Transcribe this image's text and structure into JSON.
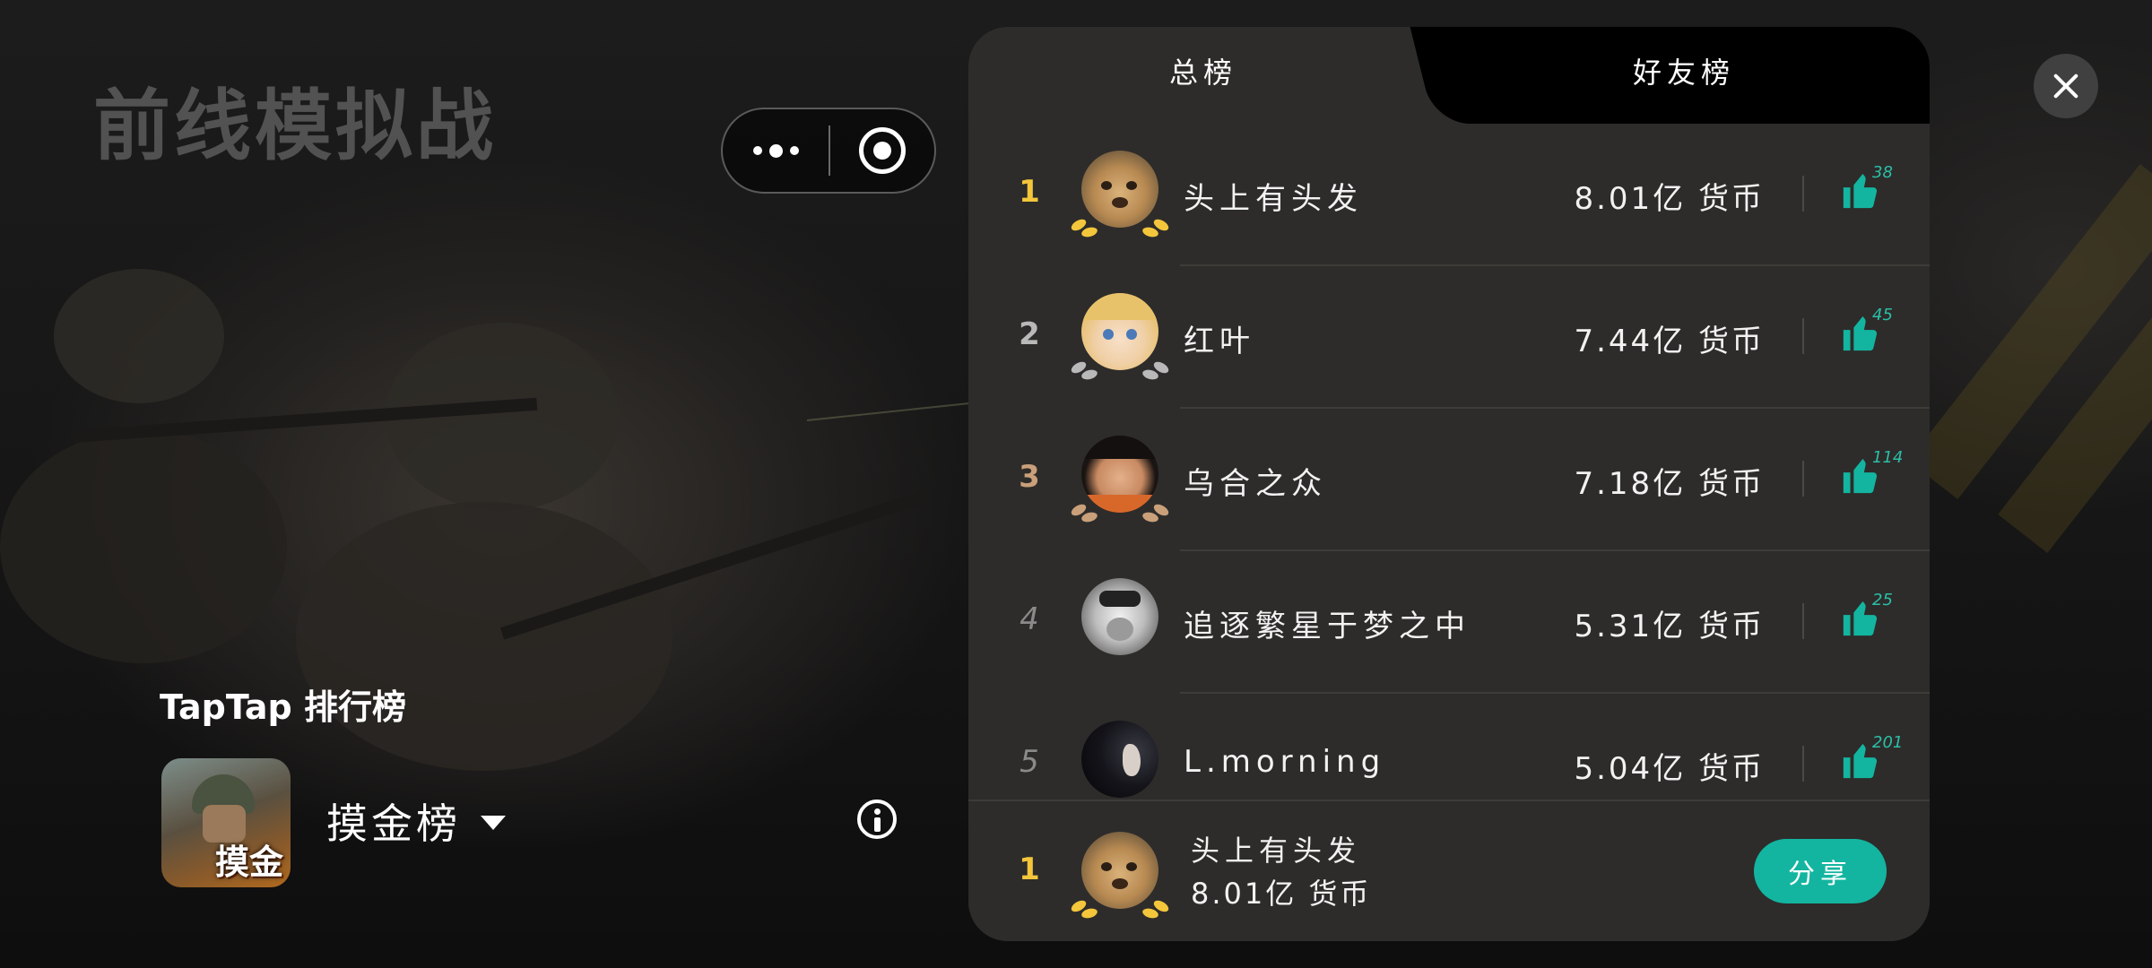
{
  "game_title": "前线模拟战",
  "leaderboard_title": "TapTap 排行榜",
  "game_icon_text": "摸金",
  "board_selector": "摸金榜",
  "tabs": [
    {
      "label": "总榜",
      "active": true
    },
    {
      "label": "好友榜",
      "active": false
    }
  ],
  "entries": [
    {
      "rank": "1",
      "name": "头上有头发",
      "score": "8.01亿 货币",
      "likes": "38"
    },
    {
      "rank": "2",
      "name": "红叶",
      "score": "7.44亿 货币",
      "likes": "45"
    },
    {
      "rank": "3",
      "name": "乌合之众",
      "score": "7.18亿 货币",
      "likes": "114"
    },
    {
      "rank": "4",
      "name": "追逐繁星于梦之中",
      "score": "5.31亿 货币",
      "likes": "25"
    },
    {
      "rank": "5",
      "name": "L.morning",
      "score": "5.04亿 货币",
      "likes": "201"
    }
  ],
  "self": {
    "rank": "1",
    "name": "头上有头发",
    "score": "8.01亿 货币"
  },
  "share_label": "分享",
  "colors": {
    "accent": "#13b5a0",
    "gold": "#f3c63b",
    "silver": "#b9b9b9",
    "bronze": "#c9a07a",
    "panel": "#2d2c2a"
  },
  "icons": {
    "close": "close-icon",
    "more": "more-dots-icon",
    "record": "record-icon",
    "info": "info-icon",
    "like": "thumbs-up-icon",
    "dropdown": "caret-down-icon"
  }
}
